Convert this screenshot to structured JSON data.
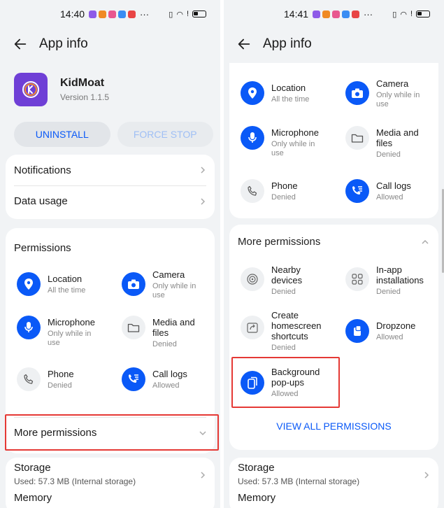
{
  "left": {
    "status_time": "14:40",
    "status_dots": "···",
    "title": "App info",
    "app": {
      "name": "KidMoat",
      "version": "Version 1.1.5"
    },
    "buttons": {
      "uninstall": "UNINSTALL",
      "force_stop": "FORCE STOP"
    },
    "rows": {
      "notifications": "Notifications",
      "data_usage": "Data usage"
    },
    "permissions": {
      "title": "Permissions",
      "items": [
        {
          "name": "Location",
          "status": "All the time"
        },
        {
          "name": "Camera",
          "status": "Only while in use"
        },
        {
          "name": "Microphone",
          "status": "Only while in use"
        },
        {
          "name": "Media and files",
          "status": "Denied"
        },
        {
          "name": "Phone",
          "status": "Denied"
        },
        {
          "name": "Call logs",
          "status": "Allowed"
        }
      ]
    },
    "more_permissions": "More permissions",
    "storage": {
      "title": "Storage",
      "used": "Used: 57.3 MB (Internal storage)"
    },
    "memory": "Memory"
  },
  "right": {
    "status_time": "14:41",
    "status_dots": "···",
    "title": "App info",
    "permissions": {
      "items": [
        {
          "name": "Location",
          "status": "All the time"
        },
        {
          "name": "Camera",
          "status": "Only while in use"
        },
        {
          "name": "Microphone",
          "status": "Only while in use"
        },
        {
          "name": "Media and files",
          "status": "Denied"
        },
        {
          "name": "Phone",
          "status": "Denied"
        },
        {
          "name": "Call logs",
          "status": "Allowed"
        }
      ]
    },
    "more_permissions": {
      "title": "More permissions",
      "items": [
        {
          "name": "Nearby devices",
          "status": "Denied"
        },
        {
          "name": "In-app installations",
          "status": "Denied"
        },
        {
          "name": "Create homescreen shortcuts",
          "status": "Denied"
        },
        {
          "name": "Dropzone",
          "status": "Allowed"
        },
        {
          "name": "Background pop-ups",
          "status": "Allowed"
        }
      ],
      "view_all": "VIEW ALL PERMISSIONS"
    },
    "storage": {
      "title": "Storage",
      "used": "Used: 57.3 MB (Internal storage)"
    },
    "memory": "Memory"
  },
  "colors": {
    "accent": "#0a59f7",
    "highlight": "#e53935",
    "app_logo": "#6f3fd6"
  }
}
